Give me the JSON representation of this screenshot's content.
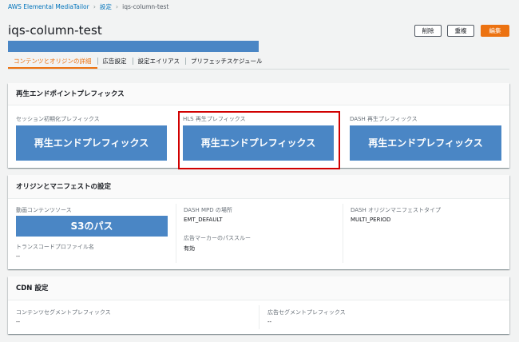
{
  "breadcrumb": {
    "service": "AWS Elemental MediaTailor",
    "settings": "設定",
    "current": "iqs-column-test"
  },
  "header": {
    "title": "iqs-column-test",
    "delete_label": "削除",
    "duplicate_label": "重複",
    "edit_label": "編集"
  },
  "tabs": [
    {
      "label": "コンテンツとオリジンの詳細",
      "active": true
    },
    {
      "label": "広告設定",
      "active": false
    },
    {
      "label": "設定エイリアス",
      "active": false
    },
    {
      "label": "プリフェッチスケジュール",
      "active": false
    }
  ],
  "playback_panel": {
    "title": "再生エンドポイントプレフィックス",
    "session_init_label": "セッション初期化プレフィックス",
    "session_init_value": "再生エンドプレフィックス",
    "hls_label": "HLS 再生プレフィックス",
    "hls_value": "再生エンドプレフィックス",
    "dash_label": "DASH 再生プレフィックス",
    "dash_value": "再生エンドプレフィックス"
  },
  "origin_panel": {
    "title": "オリジンとマニフェストの設定",
    "video_source_label": "動画コンテンツソース",
    "video_source_value": "S3のパス",
    "transcode_label": "トランスコードプロファイル名",
    "transcode_value": "--",
    "mpd_location_label": "DASH MPD の場所",
    "mpd_location_value": "EMT_DEFAULT",
    "ad_marker_label": "広告マーカーのパススルー",
    "ad_marker_value": "有効",
    "dash_manifest_type_label": "DASH オリジンマニフェストタイプ",
    "dash_manifest_type_value": "MULTI_PERIOD"
  },
  "cdn_panel": {
    "title": "CDN 設定",
    "content_segment_label": "コンテンツセグメントプレフィックス",
    "content_segment_value": "--",
    "ad_segment_label": "広告セグメントプレフィックス",
    "ad_segment_value": "--"
  },
  "colors": {
    "accent": "#ec7211",
    "link": "#0073bb",
    "redacted_block": "#4a86c5",
    "highlight_box": "#d10000"
  }
}
